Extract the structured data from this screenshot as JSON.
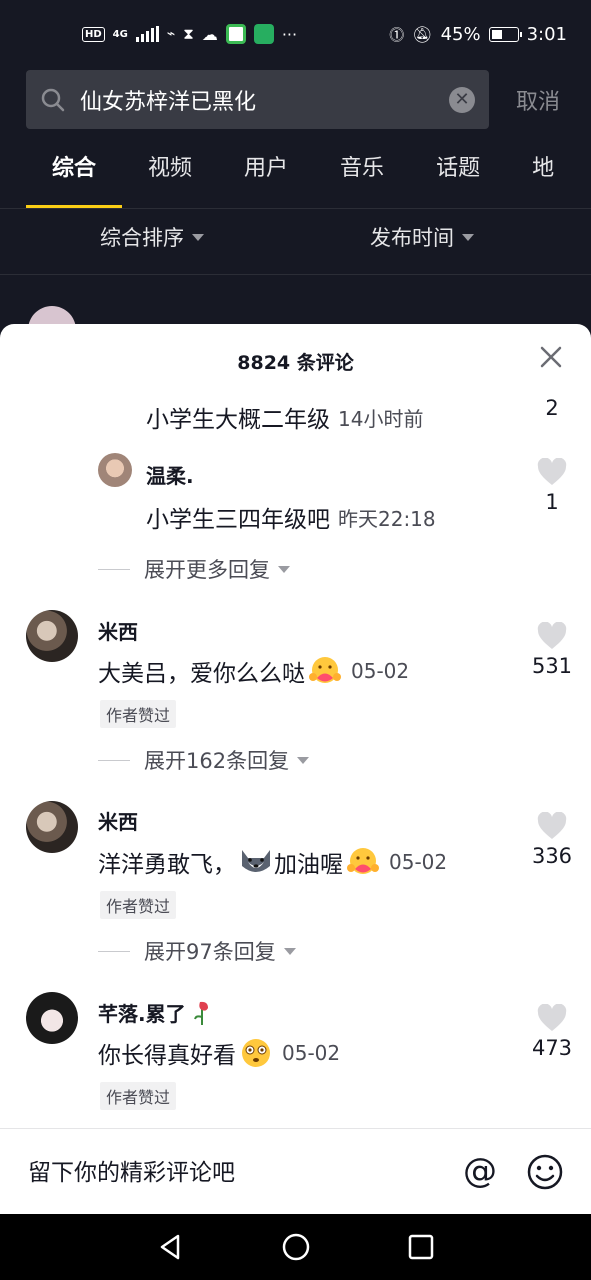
{
  "status": {
    "net": "HD",
    "gen": "4G",
    "battery_pct": "45%",
    "time": "3:01"
  },
  "search": {
    "query": "仙女苏梓洋已黑化",
    "cancel": "取消"
  },
  "tabs": [
    "综合",
    "视频",
    "用户",
    "音乐",
    "话题",
    "地"
  ],
  "sort": {
    "left": "综合排序",
    "right": "发布时间"
  },
  "sheet": {
    "title": "8824 条评论",
    "comments": [
      {
        "text": "小学生大概二年级",
        "time": "14小时前",
        "likes": "2"
      },
      {
        "name": "温柔.",
        "text": "小学生三四年级吧",
        "time": "昨天22:18",
        "likes": "1"
      },
      {
        "expand": "展开更多回复"
      },
      {
        "name": "米西",
        "text": "大美吕，爱你么么哒",
        "time": "05-02",
        "badge": "作者赞过",
        "likes": "531"
      },
      {
        "expand": "展开162条回复"
      },
      {
        "name": "米西",
        "text_a": "洋洋勇敢飞，",
        "text_b": "加油喔",
        "time": "05-02",
        "badge": "作者赞过",
        "likes": "336"
      },
      {
        "expand": "展开97条回复"
      },
      {
        "name": "芊落.累了",
        "text": "你长得真好看",
        "time": "05-02",
        "badge": "作者赞过",
        "likes": "473"
      }
    ]
  },
  "input": {
    "placeholder": "留下你的精彩评论吧"
  },
  "colors": {
    "bg_dark": "#161823",
    "accent": "#face15",
    "text_gray": "#4b4c55"
  }
}
